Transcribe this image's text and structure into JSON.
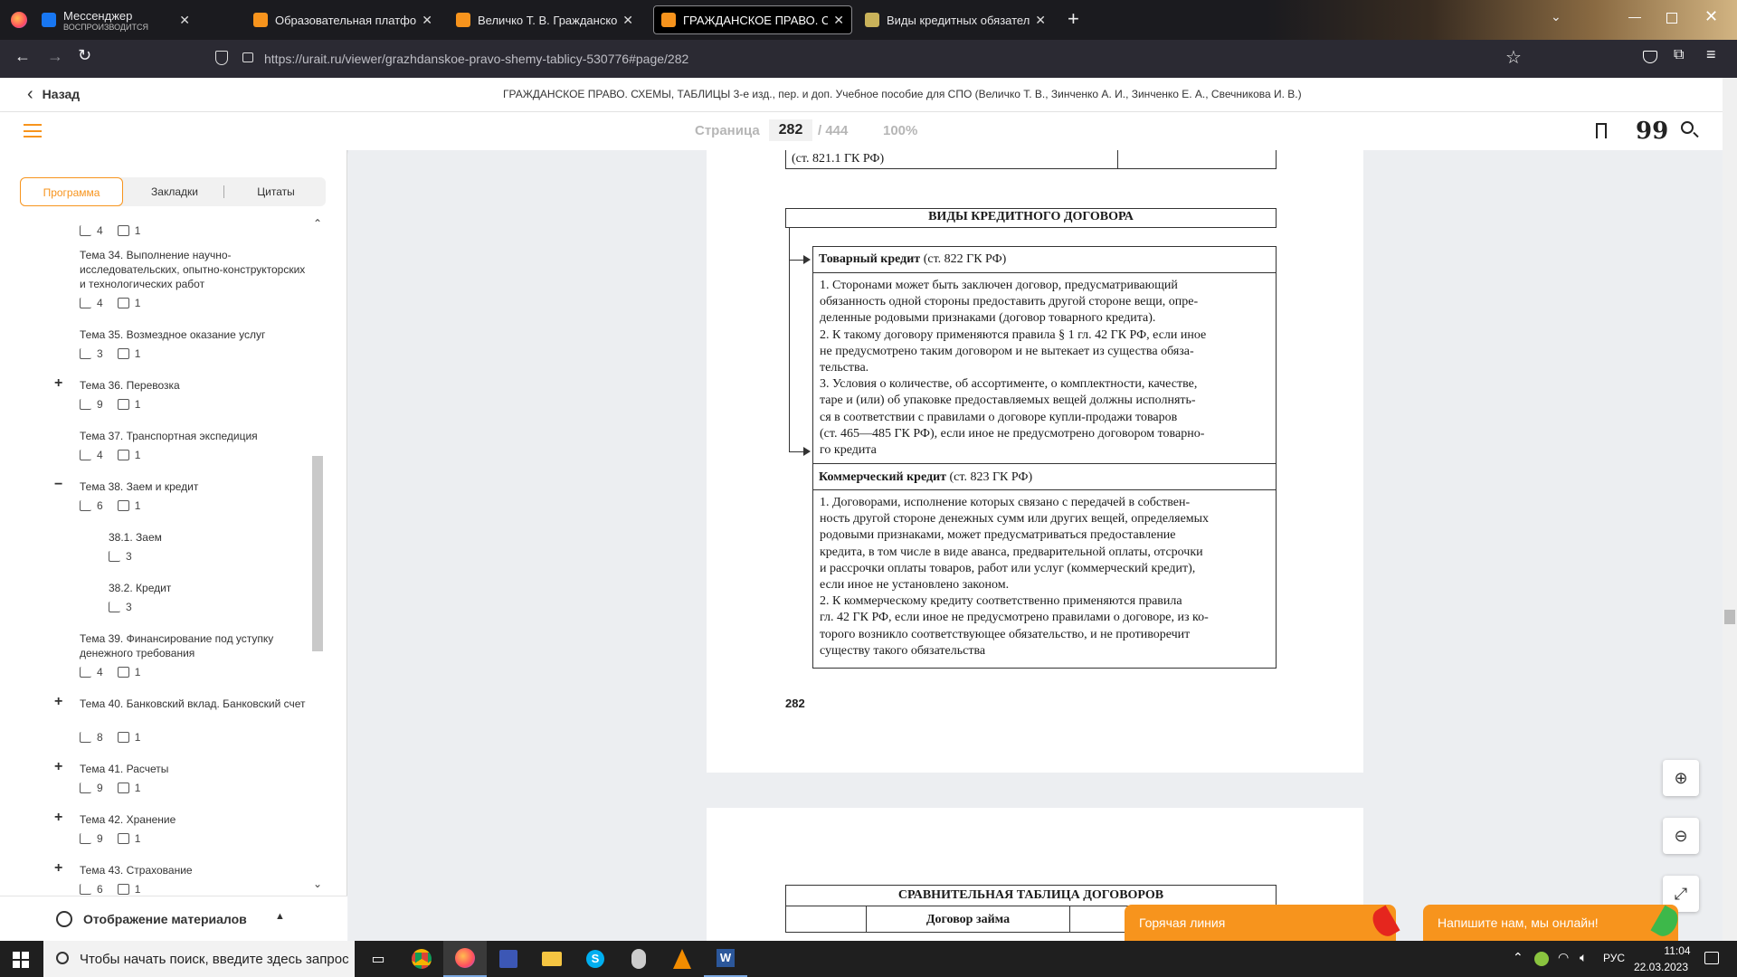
{
  "browser": {
    "tabs": [
      {
        "title": "Мессенджер",
        "subtitle": "ВОСПРОИЗВОДИТСЯ",
        "icon": "messenger-icon"
      },
      {
        "title": "Образовательная платформа",
        "icon": "urait-icon"
      },
      {
        "title": "Величко Т. В. Гражданское пр",
        "icon": "urait-icon"
      },
      {
        "title": "ГРАЖДАНСКОЕ ПРАВО. СХЕМ",
        "icon": "urait-icon"
      },
      {
        "title": "Виды кредитных обязательств",
        "icon": "page-icon"
      }
    ],
    "url": "https://urait.ru/viewer/grazhdanskoe-pravo-shemy-tablicy-530776#page/282",
    "url_host": "urait.ru"
  },
  "header": {
    "back_label": "Назад",
    "book_title": "ГРАЖДАНСКОЕ ПРАВО. СХЕМЫ, ТАБЛИЦЫ 3-е изд., пер. и доп. Учебное пособие для СПО (Величко Т. В., Зинченко А. И., Зинченко Е. А., Свечникова И. В.)"
  },
  "toolbar": {
    "page_label": "Страница",
    "page_current": "282",
    "page_total": "/ 444",
    "zoom": "100%"
  },
  "sidebar": {
    "tabs": [
      "Программа",
      "Закладки",
      "Цитаты"
    ],
    "items": [
      {
        "title": "",
        "b": "4",
        "c": "1",
        "expand": ""
      },
      {
        "title": "Тема 34. Выполнение научно-исследовательских, опытно-конструкторских и технологических работ",
        "b": "4",
        "c": "1",
        "expand": ""
      },
      {
        "title": "Тема 35. Возмездное оказание услуг",
        "b": "3",
        "c": "1",
        "expand": ""
      },
      {
        "title": "Тема 36. Перевозка",
        "b": "9",
        "c": "1",
        "expand": "+"
      },
      {
        "title": "Тема 37. Транспортная экспедиция",
        "b": "4",
        "c": "1",
        "expand": ""
      },
      {
        "title": "Тема 38. Заем и кредит",
        "b": "6",
        "c": "1",
        "expand": "−"
      },
      {
        "title": "38.1. Заем",
        "b": "3",
        "c": "",
        "expand": ""
      },
      {
        "title": "38.2. Кредит",
        "b": "3",
        "c": "",
        "expand": ""
      },
      {
        "title": "Тема 39. Финансирование под уступку денежного требования",
        "b": "4",
        "c": "1",
        "expand": ""
      },
      {
        "title": "Тема 40. Банковский вклад. Банковский счет",
        "b": "8",
        "c": "1",
        "expand": "+"
      },
      {
        "title": "Тема 41. Расчеты",
        "b": "9",
        "c": "1",
        "expand": "+"
      },
      {
        "title": "Тема 42. Хранение",
        "b": "9",
        "c": "1",
        "expand": "+"
      },
      {
        "title": "Тема 43. Страхование",
        "b": "6",
        "c": "1",
        "expand": "+"
      }
    ],
    "display_label": "Отображение материалов"
  },
  "page1": {
    "prev_cell": "(ст. 821.1 ГК РФ)",
    "heading": "ВИДЫ КРЕДИТНОГО ДОГОВОРА",
    "section1_title": "Товарный кредит",
    "section1_ref": " (ст. 822 ГК РФ)",
    "section1_lines": [
      "1.   Сторонами может быть заключен договор, предусматривающий",
      "обязанность одной стороны предоставить другой стороне вещи, опре-",
      "деленные родовыми признаками (договор товарного кредита).",
      "2.   К такому договору применяются правила § 1 гл. 42 ГК РФ, если иное",
      "не предусмотрено таким договором и не вытекает из существа обяза-",
      "тельства.",
      "3.   Условия о количестве, об ассортименте, о комплектности, качестве,",
      "таре и (или) об упаковке предоставляемых вещей должны исполнять-",
      "ся в соответствии с правилами о договоре купли-продажи товаров",
      "(ст. 465—485 ГК РФ), если иное не предусмотрено договором товарно-",
      "го кредита"
    ],
    "section2_title": "Коммерческий кредит",
    "section2_ref": " (ст. 823 ГК РФ)",
    "section2_lines": [
      "1.   Договорами, исполнение которых связано с передачей в собствен-",
      "ность другой стороне денежных сумм или других вещей, определяемых",
      "родовыми признаками, может предусматриваться предоставление",
      "кредита, в том числе в виде аванса, предварительной оплаты, отсрочки",
      "и рассрочки оплаты товаров, работ или услуг (коммерческий кредит),",
      "если иное не установлено законом.",
      "2.   К коммерческому кредиту соответственно применяются правила",
      "гл. 42 ГК РФ, если иное не предусмотрено правилами о договоре, из ко-",
      "торого возникло соответствующее обязательство, и не противоречит",
      "существу такого обязательства"
    ],
    "page_number": "282"
  },
  "page2": {
    "heading": "СРАВНИТЕЛЬНАЯ ТАБЛИЦА ДОГОВОРОВ",
    "col1": "Договор займа",
    "col2": "Кр"
  },
  "widgets": {
    "hotline": "Горячая линия",
    "chat": "Напишите нам, мы онлайн!"
  },
  "taskbar": {
    "search_placeholder": "Чтобы начать поиск, введите здесь запрос",
    "lang": "РУС",
    "time": "11:04",
    "date": "22.03.2023"
  },
  "colors": {
    "accent": "#f7941d",
    "text": "#333333"
  }
}
